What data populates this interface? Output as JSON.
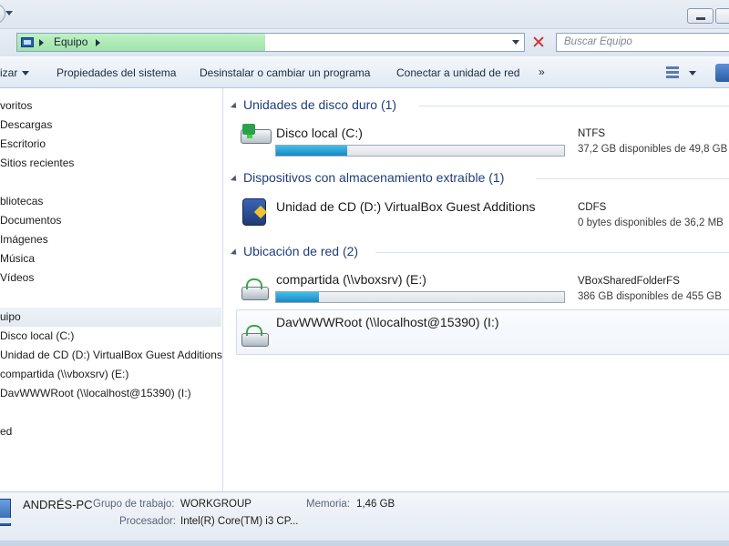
{
  "address": {
    "breadcrumb": "Equipo",
    "search_placeholder": "Buscar Equipo"
  },
  "toolbar": {
    "organize": "izar",
    "system_properties": "Propiedades del sistema",
    "uninstall": "Desinstalar o cambiar un programa",
    "map_drive": "Conectar a unidad de red",
    "more": "»"
  },
  "nav": {
    "items": [
      "vоritos",
      "Descargas",
      "Escritorio",
      "Sitios recientes",
      "bliotecas",
      "Documentos",
      "Imágenes",
      "Música",
      "Vídeos",
      "uipo",
      "Disco local (C:)",
      "Unidad de CD (D:) VirtualBox Guest Additions",
      "compartida (\\\\vboxsrv) (E:)",
      "DavWWWRoot (\\\\localhost@15390) (I:)",
      "ed"
    ]
  },
  "groups": {
    "hdd": "Unidades de disco duro (1)",
    "removable": "Dispositivos con almacenamiento extraíble (1)",
    "network": "Ubicación de red (2)"
  },
  "drives": {
    "c": {
      "name": "Disco local (C:)",
      "fs": "NTFS",
      "free": "37,2 GB disponibles de 49,8 GB",
      "used_fraction": 0.25,
      "icon": "hard-disk-icon"
    },
    "d": {
      "name": "Unidad de CD (D:) VirtualBox Guest Additions",
      "fs": "CDFS",
      "free": "0 bytes disponibles de 36,2 MB",
      "icon": "cd-drive-icon"
    },
    "e": {
      "name": "compartida (\\\\vboxsrv) (E:)",
      "fs": "VBoxSharedFolderFS",
      "free": "386 GB disponibles de 455 GB",
      "used_fraction": 0.15,
      "icon": "network-drive-icon"
    },
    "i": {
      "name": "DavWWWRoot (\\\\localhost@15390) (I:)",
      "icon": "network-drive-icon"
    }
  },
  "details": {
    "computer_name": "ANDRÉS-PC",
    "workgroup_label": "Grupo de trabajo:",
    "workgroup_value": "WORKGROUP",
    "memory_label": "Memoria:",
    "memory_value": "1,46 GB",
    "processor_label": "Procesador:",
    "processor_value": "Intel(R) Core(TM) i3 CP..."
  },
  "colors": {
    "address_progress": "#9fe3a8",
    "bar_fill": "#1b87c1",
    "group_header": "#1e3e7a"
  }
}
